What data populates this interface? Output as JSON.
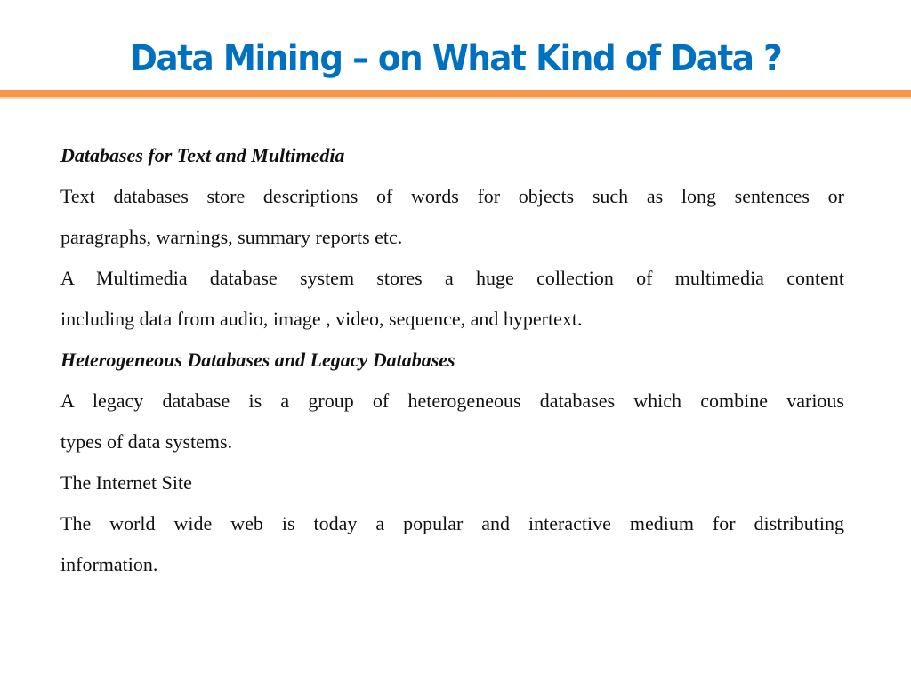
{
  "slide": {
    "title": "Data Mining – on What Kind of Data ?",
    "accent_colors": {
      "title": "#0070C0",
      "rule": "#F79646"
    },
    "sections": [
      {
        "heading": "Databases for Text and Multimedia",
        "lines": [
          "Text databases store descriptions of words for objects such as long sentences or",
          "paragraphs, warnings, summary reports etc.",
          "A Multimedia database system stores a huge collection of multimedia content",
          "including data from audio, image , video, sequence, and hypertext."
        ]
      },
      {
        "heading": "Heterogeneous Databases and Legacy Databases",
        "lines": [
          "A legacy database is a group of heterogeneous databases which combine various",
          "types of data systems.",
          "The Internet Site",
          "The world wide web is today a popular and interactive medium for distributing",
          "information."
        ]
      }
    ]
  }
}
